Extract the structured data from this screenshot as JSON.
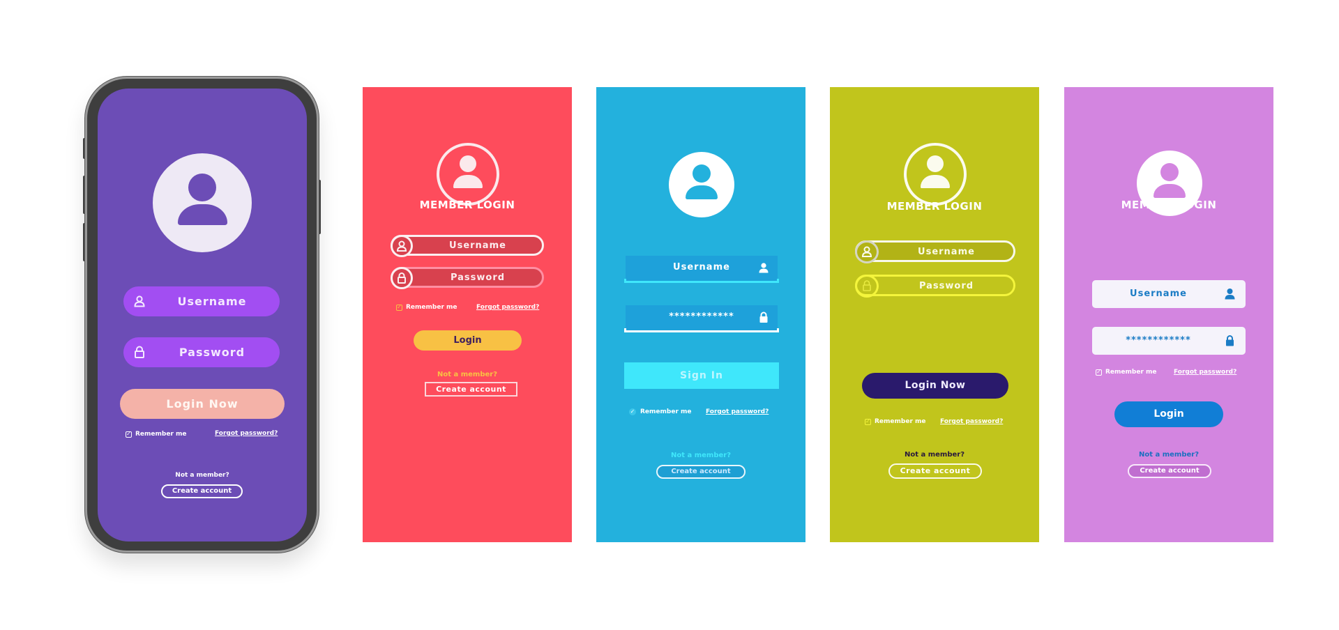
{
  "phone": {
    "username_placeholder": "Username",
    "password_placeholder": "Password",
    "login_label": "Login Now",
    "remember_label": "Remember me",
    "remember_checked": true,
    "forgot_label": "Forgot password?",
    "not_member_label": "Not a member?",
    "create_label": "Create account",
    "colors": {
      "screen": "#6c4db6",
      "field": "#a24ef2",
      "button": "#f4b2a8"
    }
  },
  "red_panel": {
    "title": "MEMBER LOGIN",
    "username_placeholder": "Username",
    "password_placeholder": "Password",
    "remember_label": "Remember me",
    "remember_checked": true,
    "forgot_label": "Forgot password?",
    "login_label": "Login",
    "not_member_label": "Not a member?",
    "create_label": "Create account",
    "colors": {
      "background": "#fe4c5c",
      "button": "#f8c144",
      "accent": "#f8c144"
    }
  },
  "blue_panel": {
    "username_placeholder": "Username",
    "password_value": "************",
    "signin_label": "Sign In",
    "remember_label": "Remember me",
    "remember_checked": true,
    "forgot_label": "Forgot password?",
    "not_member_label": "Not a member?",
    "create_label": "Create account",
    "colors": {
      "background": "#23b1dd",
      "button": "#3fe7fb",
      "accent": "#3fe7fb"
    }
  },
  "olive_panel": {
    "title": "MEMBER LOGIN",
    "username_placeholder": "Username",
    "password_placeholder": "Password",
    "login_label": "Login Now",
    "remember_label": "Remember me",
    "remember_checked": true,
    "forgot_label": "Forgot password?",
    "not_member_label": "Not a member?",
    "create_label": "Create account",
    "colors": {
      "background": "#c1c51c",
      "button": "#2a1a6c",
      "accent": "#f4f53c"
    }
  },
  "pink_panel": {
    "title": "MEMBER LOGIN",
    "username_placeholder": "Username",
    "password_value": "************",
    "remember_label": "Remember me",
    "remember_checked": true,
    "forgot_label": "Forgot password?",
    "login_label": "Login",
    "not_member_label": "Not a member?",
    "create_label": "Create account",
    "colors": {
      "background": "#d385e0",
      "button": "#117ed6",
      "accent": "#1b7cc5"
    }
  },
  "icons": {
    "user": "user-icon",
    "lock": "lock-icon",
    "avatar": "avatar-icon",
    "checkbox": "checkbox-checked-icon"
  }
}
